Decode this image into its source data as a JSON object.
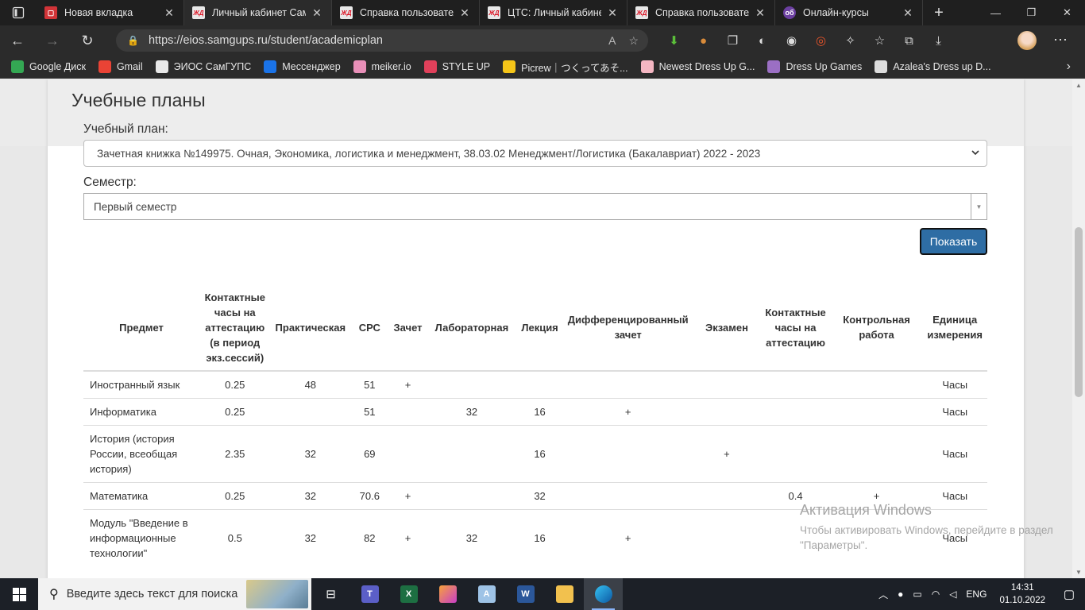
{
  "browser": {
    "tabs": [
      {
        "title": "Новая вкладка",
        "favicon": "red-tile-icon",
        "active": false
      },
      {
        "title": "Личный кабинет Сам",
        "favicon": "rzd-icon",
        "active": true
      },
      {
        "title": "Справка пользовател",
        "favicon": "rzd-icon",
        "active": false
      },
      {
        "title": "ЦТС: Личный кабине",
        "favicon": "rzd-icon",
        "active": false
      },
      {
        "title": "Справка пользовател",
        "favicon": "rzd-icon",
        "active": false
      },
      {
        "title": "Онлайн-курсы",
        "favicon": "ob-icon",
        "active": false
      }
    ],
    "url": "https://eios.samgups.ru/student/academicplan",
    "bookmarks": [
      {
        "label": "Google Диск",
        "color": "#34a853"
      },
      {
        "label": "Gmail",
        "color": "#ea4335"
      },
      {
        "label": "ЭИОС СамГУПС",
        "color": "#2b6cb0"
      },
      {
        "label": "Мессенджер",
        "color": "#1a73e8"
      },
      {
        "label": "meiker.io",
        "color": "#e88fb8"
      },
      {
        "label": "STYLE UP",
        "color": "#e0405a"
      },
      {
        "label": "Picrew｜つくってあそ...",
        "color": "#f5c518"
      },
      {
        "label": "Newest Dress Up G...",
        "color": "#f4b6c2"
      },
      {
        "label": "Dress Up Games",
        "color": "#9b6fc4"
      },
      {
        "label": "Azalea's Dress up D...",
        "color": "#dddddd"
      }
    ]
  },
  "page": {
    "title": "Учебные планы",
    "plan_label": "Учебный план:",
    "plan_value": "Зачетная книжка №149975. Очная, Экономика, логистика и менеджмент, 38.03.02 Менеджмент/Логистика (Бакалавриат) 2022 - 2023",
    "semester_label": "Семестр:",
    "semester_value": "Первый семестр",
    "show_button": "Показать",
    "table": {
      "headers": [
        "Предмет",
        "Контактные часы на аттестацию (в период экз.сессий)",
        "Практическая",
        "СРС",
        "Зачет",
        "Лабораторная",
        "Лекция",
        "Дифференцированный зачет",
        "Экзамен",
        "Контактные часы на аттестацию",
        "Контрольная работа",
        "Единица измерения"
      ],
      "rows": [
        [
          "Иностранный язык",
          "0.25",
          "48",
          "51",
          "+",
          "",
          "",
          "",
          "",
          "",
          "",
          "Часы"
        ],
        [
          "Информатика",
          "0.25",
          "",
          "51",
          "",
          "32",
          "16",
          "+",
          "",
          "",
          "",
          "Часы"
        ],
        [
          "История (история России, всеобщая история)",
          "2.35",
          "32",
          "69",
          "",
          "",
          "16",
          "",
          "+",
          "",
          "",
          "Часы"
        ],
        [
          "Математика",
          "0.25",
          "32",
          "70.6",
          "+",
          "",
          "32",
          "",
          "",
          "0.4",
          "+",
          "Часы"
        ],
        [
          "Модуль \"Введение в информационные технологии\"",
          "0.5",
          "32",
          "82",
          "+",
          "32",
          "16",
          "+",
          "",
          "",
          "",
          "Часы"
        ]
      ]
    }
  },
  "watermark": {
    "line1": "Активация Windows",
    "line2": "Чтобы активировать Windows, перейдите в раздел \"Параметры\"."
  },
  "taskbar": {
    "search_placeholder": "Введите здесь текст для поиска",
    "lang": "ENG",
    "time": "14:31",
    "date": "01.10.2022"
  }
}
